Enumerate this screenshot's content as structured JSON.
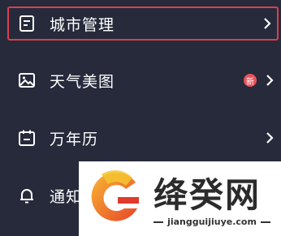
{
  "menu": {
    "items": [
      {
        "label": "城市管理",
        "icon": "note-icon",
        "highlighted": true
      },
      {
        "label": "天气美图",
        "icon": "image-icon",
        "badge": "新"
      },
      {
        "label": "万年历",
        "icon": "calendar-icon"
      },
      {
        "label": "通知",
        "icon": "bell-icon"
      }
    ]
  },
  "watermark": {
    "title": "绛癸网",
    "url": "jiangguijiuye.com"
  },
  "colors": {
    "background": "#262a3b",
    "highlight_border": "#d8404a",
    "badge": "#e8525b"
  }
}
